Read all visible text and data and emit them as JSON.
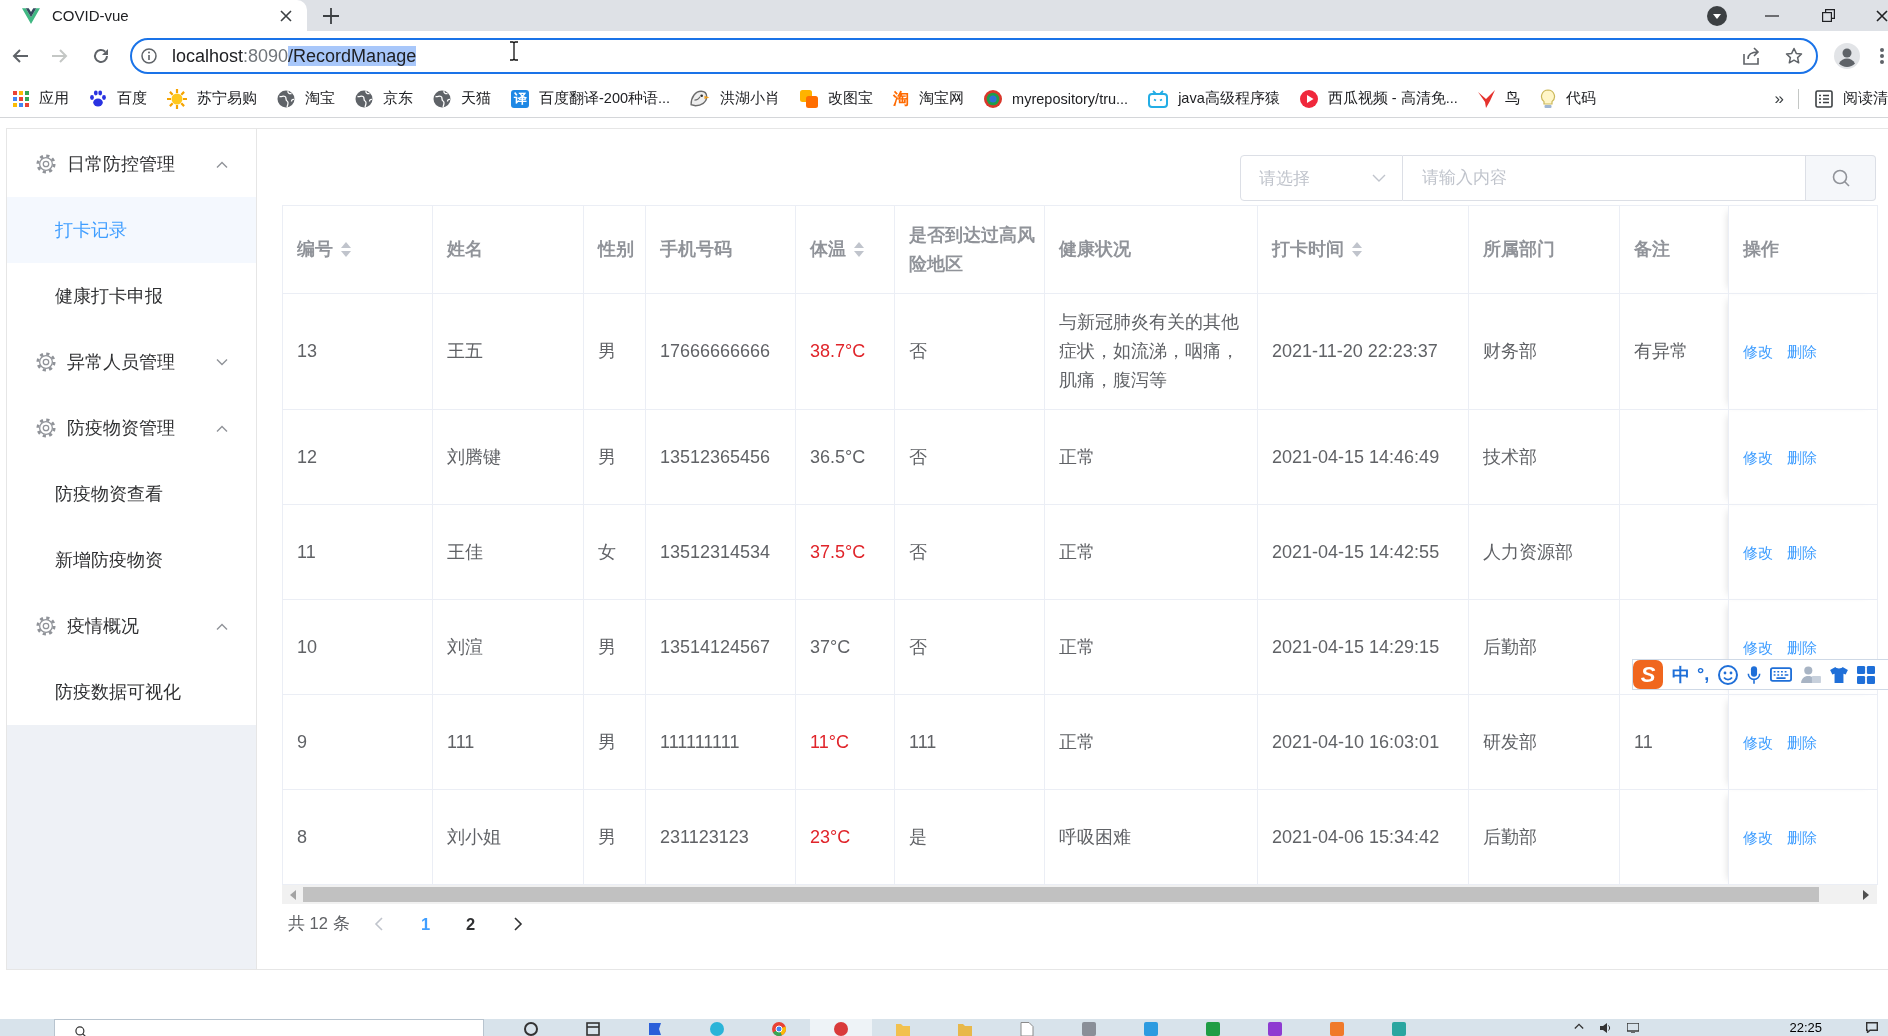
{
  "browser": {
    "tab": {
      "title": "COVID-vue"
    },
    "navigation": {
      "back": {
        "disabled": false
      },
      "forward": {
        "disabled": true
      }
    },
    "address": {
      "host": "localhost",
      "port": ":8090",
      "path": "/RecordManage",
      "path_selected": true
    },
    "bookmarks": [
      {
        "label": "应用",
        "kind": "apps"
      },
      {
        "label": "百度",
        "kind": "paw"
      },
      {
        "label": "苏宁易购",
        "kind": "sun"
      },
      {
        "label": "淘宝",
        "kind": "globe"
      },
      {
        "label": "京东",
        "kind": "globe"
      },
      {
        "label": "天猫",
        "kind": "globe"
      },
      {
        "label": "百度翻译-200种语...",
        "kind": "letter-tile",
        "icon_text": "译"
      },
      {
        "label": "洪湖小肖",
        "kind": "bird"
      },
      {
        "label": "改图宝",
        "kind": "tiles"
      },
      {
        "label": "淘宝网",
        "kind": "letter",
        "icon_text": "淘"
      },
      {
        "label": "myrepository/tru...",
        "kind": "ring"
      },
      {
        "label": "java高级程序猿",
        "kind": "tv"
      },
      {
        "label": "西瓜视频 - 高清免...",
        "kind": "play"
      },
      {
        "label": "鸟",
        "kind": "swallow"
      },
      {
        "label": "代码",
        "kind": "bulb"
      }
    ],
    "more_bookmarks": "»",
    "reading_list": "阅读清"
  },
  "sidebar": {
    "groups": [
      {
        "label": "日常防控管理",
        "expanded": true,
        "children": [
          {
            "label": "打卡记录",
            "selected": true
          },
          {
            "label": "健康打卡申报",
            "selected": false
          }
        ]
      },
      {
        "label": "异常人员管理",
        "expanded": false
      },
      {
        "label": "防疫物资管理",
        "expanded": true,
        "children": [
          {
            "label": "防疫物资查看",
            "selected": false
          },
          {
            "label": "新增防疫物资",
            "selected": false
          }
        ]
      },
      {
        "label": "疫情概况",
        "expanded": true,
        "children": [
          {
            "label": "防疫数据可视化",
            "selected": false
          }
        ]
      }
    ]
  },
  "search": {
    "select_placeholder": "请选择",
    "placeholder": "请输入内容"
  },
  "table": {
    "columns": [
      {
        "label": "编号",
        "sortable": true
      },
      {
        "label": "姓名",
        "sortable": false
      },
      {
        "label": "性别",
        "sortable": false
      },
      {
        "label": "手机号码",
        "sortable": false
      },
      {
        "label": "体温",
        "sortable": true
      },
      {
        "label": "是否到达过高风险地区",
        "sortable": false
      },
      {
        "label": "健康状况",
        "sortable": false
      },
      {
        "label": "打卡时间",
        "sortable": true
      },
      {
        "label": "所属部门",
        "sortable": false
      },
      {
        "label": "备注",
        "sortable": false
      },
      {
        "label": "操作",
        "sortable": false
      }
    ],
    "rows": [
      {
        "id": "13",
        "name": "王五",
        "gender": "男",
        "phone": "17666666666",
        "temperature": "38.7°C",
        "temperature_alert": true,
        "visited_risk_area": "否",
        "health": "与新冠肺炎有关的其他症状，如流涕，咽痛，肌痛，腹泻等",
        "check_in_time": "2021-11-20 22:23:37",
        "department": "财务部",
        "remark": "有异常",
        "actions": [
          "修改",
          "删除"
        ]
      },
      {
        "id": "12",
        "name": "刘腾键",
        "gender": "男",
        "phone": "13512365456",
        "temperature": "36.5°C",
        "temperature_alert": false,
        "visited_risk_area": "否",
        "health": "正常",
        "check_in_time": "2021-04-15 14:46:49",
        "department": "技术部",
        "actions": [
          "修改",
          "删除"
        ]
      },
      {
        "id": "11",
        "name": "王佳",
        "gender": "女",
        "phone": "13512314534",
        "temperature": "37.5°C",
        "temperature_alert": true,
        "visited_risk_area": "否",
        "health": "正常",
        "check_in_time": "2021-04-15 14:42:55",
        "department": "人力资源部",
        "actions": [
          "修改",
          "删除"
        ]
      },
      {
        "id": "10",
        "name": "刘渲",
        "gender": "男",
        "phone": "13514124567",
        "temperature": "37°C",
        "temperature_alert": false,
        "visited_risk_area": "否",
        "health": "正常",
        "check_in_time": "2021-04-15 14:29:15",
        "department": "后勤部",
        "actions": [
          "修改",
          "删除"
        ]
      },
      {
        "id": "9",
        "name": "111",
        "gender": "男",
        "phone": "111111111",
        "temperature": "11°C",
        "temperature_alert": true,
        "visited_risk_area": "111",
        "health": "正常",
        "check_in_time": "2021-04-10 16:03:01",
        "department": "研发部",
        "remark": "11",
        "actions": [
          "修改",
          "删除"
        ]
      },
      {
        "id": "8",
        "name": "刘小姐",
        "gender": "男",
        "phone": "231123123",
        "temperature": "23°C",
        "temperature_alert": true,
        "visited_risk_area": "是",
        "health": "呼吸困难",
        "check_in_time": "2021-04-06 15:34:42",
        "department": "后勤部",
        "actions": [
          "修改",
          "删除"
        ]
      }
    ]
  },
  "pagination": {
    "total": "共 12 条",
    "prev": {
      "disabled": true
    },
    "pages": [
      {
        "label": "1",
        "selected": true
      },
      {
        "label": "2",
        "selected": false
      }
    ],
    "next": {
      "disabled": false
    }
  },
  "ime_toolbar": {
    "logo": "S",
    "mode": "中",
    "punctuation": "°,"
  },
  "taskbar": {
    "clock": "22:25"
  }
}
